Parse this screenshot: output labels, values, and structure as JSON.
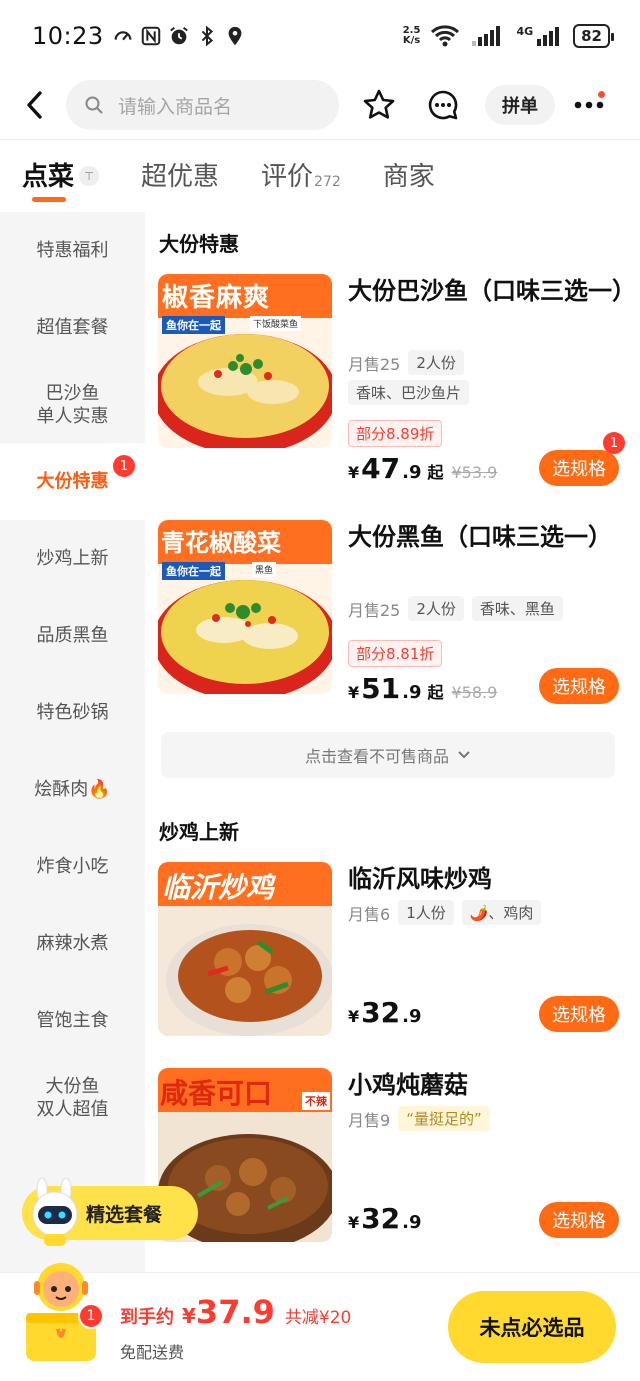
{
  "status_bar": {
    "time": "10:23",
    "net_speed_top": "2.5",
    "net_speed_bottom": "K/s",
    "network": "4G",
    "battery": "82"
  },
  "header": {
    "search_placeholder": "请输入商品名",
    "group_buy_label": "拼单"
  },
  "tabs": [
    {
      "label": "点菜",
      "sub": "",
      "icon": "pin-top-icon"
    },
    {
      "label": "超优惠",
      "sub": ""
    },
    {
      "label": "评价",
      "sub": "272"
    },
    {
      "label": "商家",
      "sub": ""
    }
  ],
  "sidebar": {
    "items": [
      {
        "label": "特惠福利"
      },
      {
        "label": "超值套餐"
      },
      {
        "label": "巴沙鱼\n单人实惠"
      },
      {
        "label": "大份特惠",
        "badge": "1"
      },
      {
        "label": "炒鸡上新"
      },
      {
        "label": "品质黑鱼"
      },
      {
        "label": "特色砂锅"
      },
      {
        "label": "烩酥肉🔥"
      },
      {
        "label": "炸食小吃"
      },
      {
        "label": "麻辣水煮"
      },
      {
        "label": "管饱主食"
      },
      {
        "label": "大份鱼\n双人超值"
      }
    ]
  },
  "sections": [
    {
      "title": "大份特惠",
      "products": [
        {
          "name": "大份巴沙鱼（口味三选一）",
          "sales": "月售25",
          "tags": [
            "2人份",
            "香味、巴沙鱼片"
          ],
          "discount": "部分8.89折",
          "price_currency": "¥",
          "price_int": "47",
          "price_dec": ".9",
          "price_suffix": "起",
          "price_orig": "¥53.9",
          "button": "选规格",
          "button_badge": "1",
          "image_text": "椒香麻爽",
          "image_sub": "鱼你在一起",
          "image_tag": "下饭酸菜鱼"
        },
        {
          "name": "大份黑鱼（口味三选一）",
          "sales": "月售25",
          "tags": [
            "2人份",
            "香味、黑鱼"
          ],
          "discount": "部分8.81折",
          "price_currency": "¥",
          "price_int": "51",
          "price_dec": ".9",
          "price_suffix": "起",
          "price_orig": "¥58.9",
          "button": "选规格",
          "image_text": "青花椒酸菜",
          "image_sub": "鱼你在一起",
          "image_tag": "黑鱼"
        }
      ],
      "unavailable_label": "点击查看不可售商品"
    },
    {
      "title": "炒鸡上新",
      "products": [
        {
          "name": "临沂风味炒鸡",
          "sales": "月售6",
          "tags": [
            "1人份",
            "🌶️、鸡肉"
          ],
          "price_currency": "¥",
          "price_int": "32",
          "price_dec": ".9",
          "button": "选规格",
          "image_text": "临沂炒鸡"
        },
        {
          "name": "小鸡炖蘑菇",
          "sales": "月售9",
          "tags": [
            "“量挺足的”"
          ],
          "price_currency": "¥",
          "price_int": "32",
          "price_dec": ".9",
          "button": "选规格",
          "image_text": "咸香可口",
          "image_tag": "不辣"
        }
      ]
    }
  ],
  "floating_combo": {
    "label": "精选套餐"
  },
  "bottom_bar": {
    "cart_badge": "1",
    "total_label": "到手约",
    "currency": "¥",
    "total_amount": "37.9",
    "savings": "共减¥20",
    "shipping": "免配送费",
    "checkout_label": "未点必选品"
  },
  "colors": {
    "accent": "#ff6a14",
    "price_red": "#ff3b30",
    "cta_yellow": "#ffd92e"
  }
}
